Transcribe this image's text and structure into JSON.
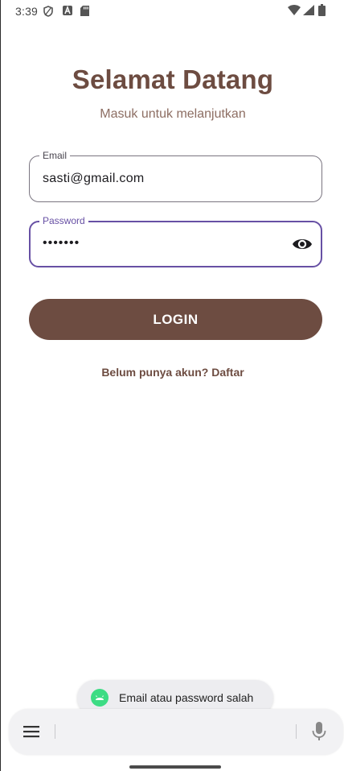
{
  "status_bar": {
    "time": "3:39",
    "icons": [
      "shield-icon",
      "a-box-icon",
      "sd-card-icon",
      "wifi-icon",
      "signal-icon",
      "battery-icon"
    ]
  },
  "header": {
    "title": "Selamat Datang",
    "subtitle": "Masuk untuk melanjutkan"
  },
  "form": {
    "email": {
      "label": "Email",
      "value": "sasti@gmail.com"
    },
    "password": {
      "label": "Password",
      "value": "•••••••",
      "toggle_icon": "eye-icon"
    },
    "login_label": "LOGIN",
    "register_link": "Belum punya akun? Daftar"
  },
  "toast": {
    "icon": "android-icon",
    "message": "Email atau password salah"
  },
  "keyboard_bar": {
    "icons": [
      "menu-icon",
      "mic-icon"
    ]
  },
  "colors": {
    "brand_brown": "#6d4c41",
    "subtitle_brown": "#8d6e63",
    "focus_purple": "#6750a4",
    "android_green": "#3ddc84"
  }
}
